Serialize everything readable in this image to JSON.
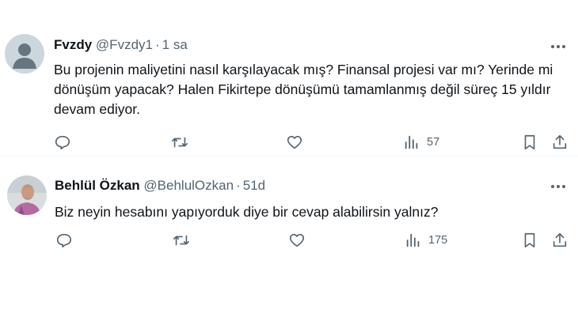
{
  "tweets": [
    {
      "name": "Fvzdy",
      "handle": "@Fvzdy1",
      "separator": "·",
      "time": "1 sa",
      "text": "Bu projenin maliyetini nasıl karşılayacak mış? Finansal projesi var mı? Yerinde mi dönüşüm yapacak? Halen Fikirtepe dönüşümü tamamlanmış değil süreç 15 yıldır devam ediyor.",
      "views": "57",
      "avatar": "default-avatar"
    },
    {
      "name": "Behlül Özkan",
      "handle": "@BehlulOzkan",
      "separator": "·",
      "time": "51d",
      "text": "Biz neyin hesabını yapıyorduk diye bir cevap alabilirsin yalnız?",
      "views": "175",
      "avatar": "user-photo-avatar"
    }
  ],
  "icons": {
    "reply": "reply-icon",
    "retweet": "retweet-icon",
    "like": "heart-icon",
    "views": "views-chart-icon",
    "bookmark": "bookmark-icon",
    "share": "share-icon",
    "more": "more-dots-icon"
  },
  "colors": {
    "text": "#0f1419",
    "secondary": "#536471",
    "divider": "#eff3f4"
  }
}
